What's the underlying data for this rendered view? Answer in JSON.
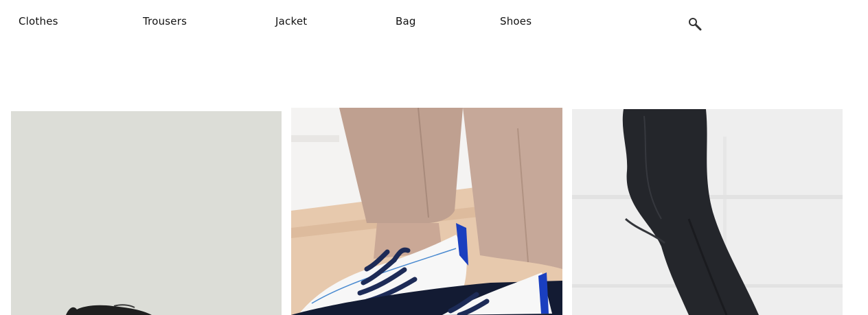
{
  "nav": {
    "items": [
      {
        "label": "Clothes"
      },
      {
        "label": "Trousers"
      },
      {
        "label": "Jacket"
      },
      {
        "label": "Bag"
      },
      {
        "label": "Shoes"
      }
    ],
    "search_icon": "magnifier-icon"
  },
  "gallery": {
    "tiles": [
      {
        "image": "black-shoe-on-grey-background",
        "background": "#dcddd7"
      },
      {
        "image": "beige-trousers-white-sneakers-navy-laces",
        "background": "#e6c9ad"
      },
      {
        "image": "black-jeans-on-white-wall",
        "background": "#eeeeee"
      }
    ]
  },
  "colors": {
    "text": "#111111",
    "page_background": "#ffffff"
  }
}
